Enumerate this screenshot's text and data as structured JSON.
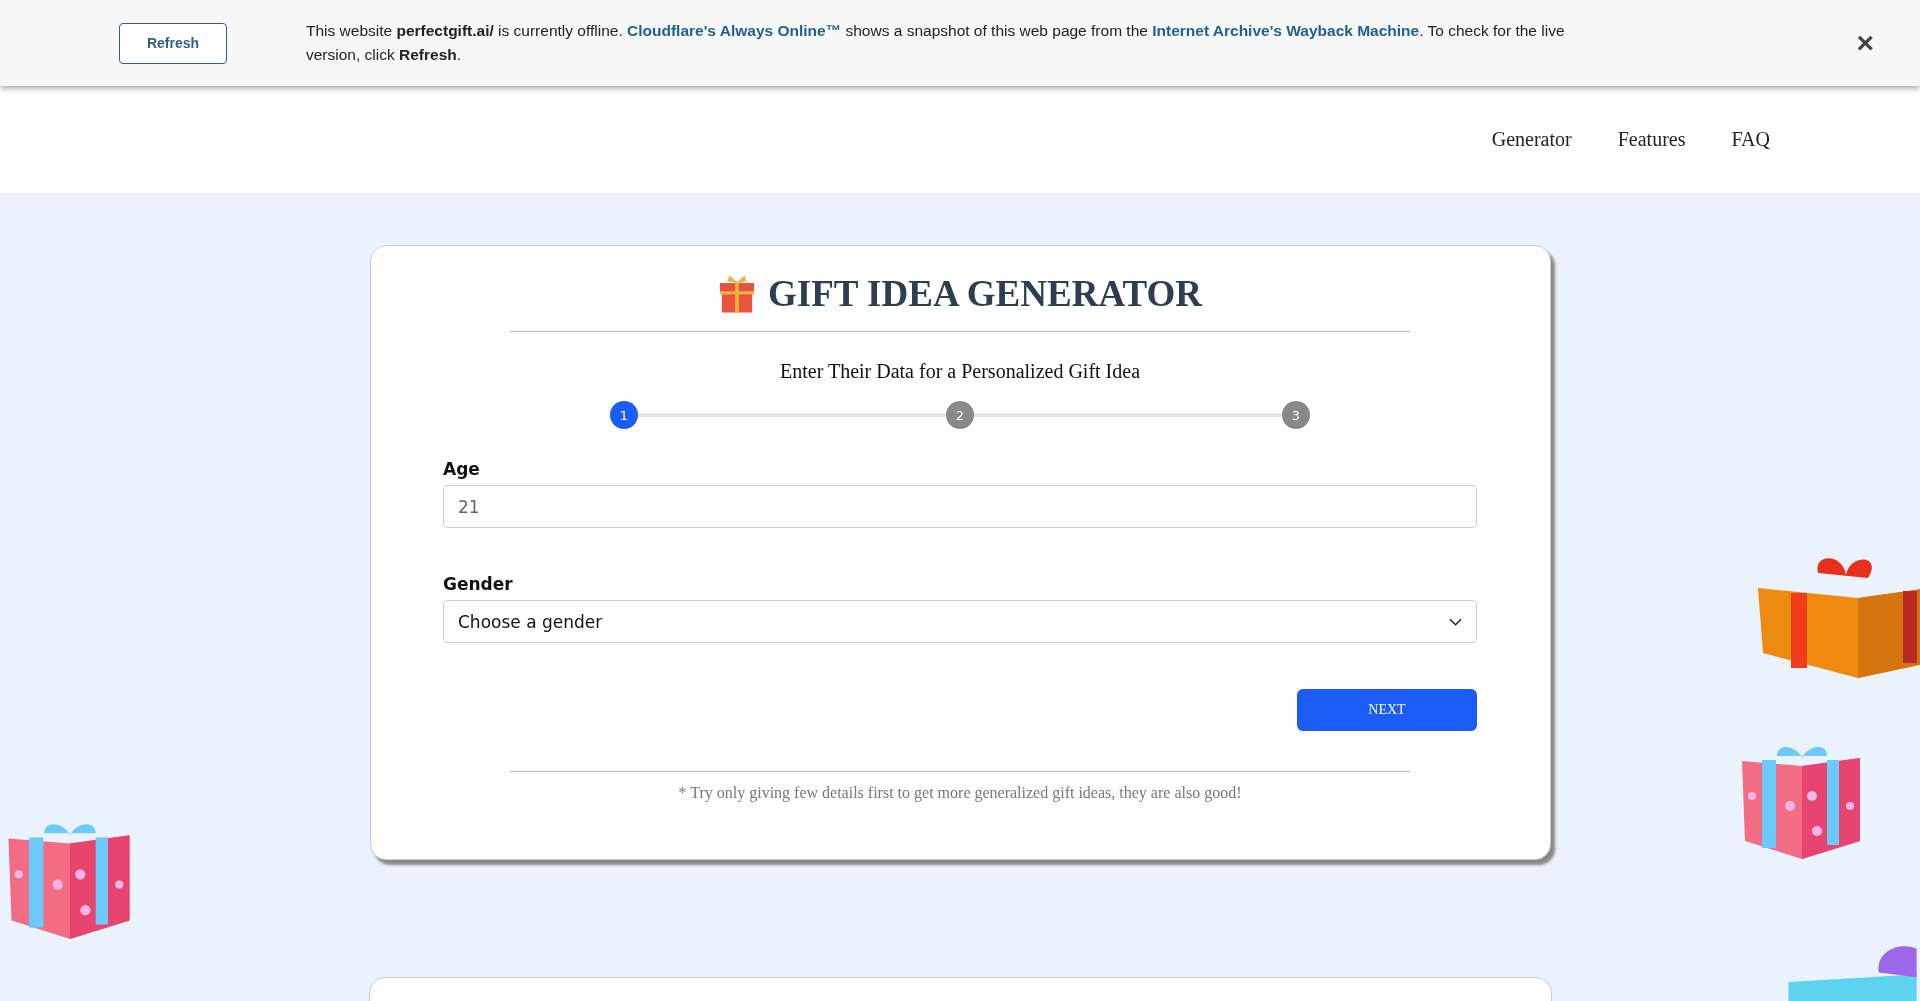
{
  "notice": {
    "button": "Refresh",
    "parts": [
      {
        "kind": "text",
        "text": "This website **perfectgift.ai/** is currently offline. "
      },
      {
        "kind": "link",
        "text": "Cloudflare's Always Online™"
      },
      {
        "kind": "text",
        "text": " shows a snapshot of this web page from the "
      },
      {
        "kind": "link",
        "text": "Internet Archive's Wayback Machine"
      },
      {
        "kind": "text",
        "text": ". To check for the live version, click **Refresh**."
      }
    ],
    "close": "×"
  },
  "nav": [
    "Generator",
    "Features",
    "FAQ"
  ],
  "card": {
    "title": "GIFT IDEA GENERATOR",
    "subtitle": "Enter Their Data for a Personalized Gift Idea",
    "steps": [
      {
        "label": "1",
        "selected": true
      },
      {
        "label": "2",
        "selected": false
      },
      {
        "label": "3",
        "selected": false
      }
    ],
    "fields": [
      {
        "kind": "input",
        "label": "Age",
        "value": "21"
      },
      {
        "kind": "select",
        "label": "Gender",
        "value": "Choose a gender"
      }
    ],
    "button": "NEXT",
    "footnote": "* Try only giving few details first to get more generalized gift ideas, they are also good!"
  }
}
